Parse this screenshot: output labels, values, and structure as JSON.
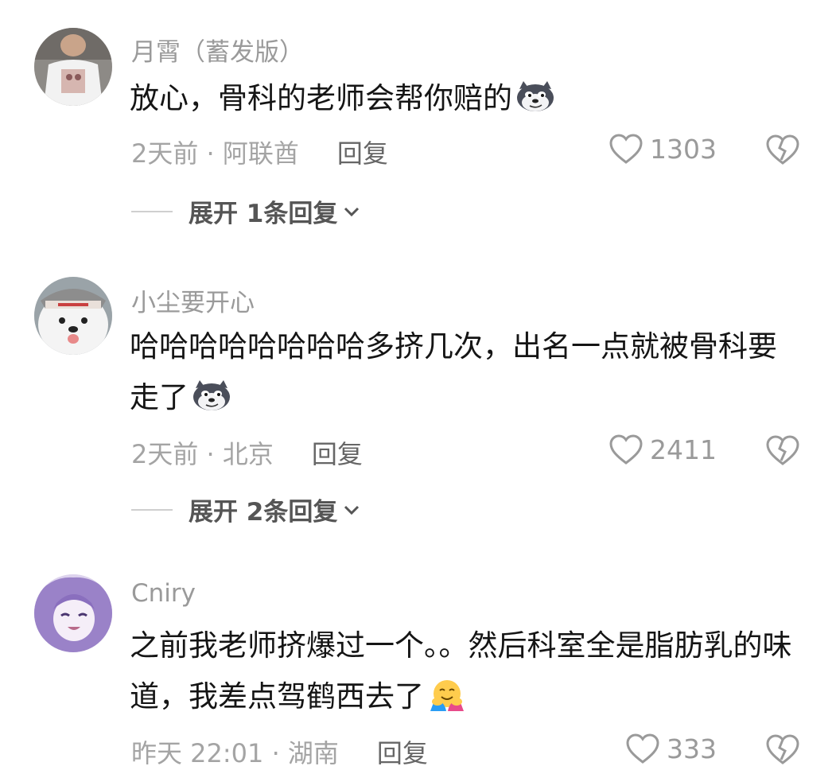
{
  "comments": [
    {
      "username": "月霄（蓄发版）",
      "text": "放心，骨科的老师会帮你赔的",
      "emoji": "husky-smirk-emoji",
      "time": "2天前 · 阿联酋",
      "reply_label": "回复",
      "likes": "1303",
      "expand_label": "展开 1条回复"
    },
    {
      "username": "小尘要开心",
      "text": "哈哈哈哈哈哈哈哈多挤几次，出名一点就被骨科要走了",
      "emoji": "husky-smirk-emoji",
      "time": "2天前 · 北京",
      "reply_label": "回复",
      "likes": "2411",
      "expand_label": "展开 2条回复"
    },
    {
      "username": "Cniry",
      "text": "之前我老师挤爆过一个。。然后科室全是脂肪乳的味道，我差点驾鹤西去了",
      "emoji": "hug-face-emoji",
      "time": "昨天 22:01 · 湖南",
      "reply_label": "回复",
      "likes": "333"
    }
  ],
  "icons": {
    "like": "heart-outline-icon",
    "dislike": "broken-heart-icon",
    "expand": "chevron-down-icon"
  },
  "colors": {
    "username": "#9a9a9a",
    "text": "#151515",
    "meta": "#a4a4a4",
    "expand": "#555555"
  }
}
